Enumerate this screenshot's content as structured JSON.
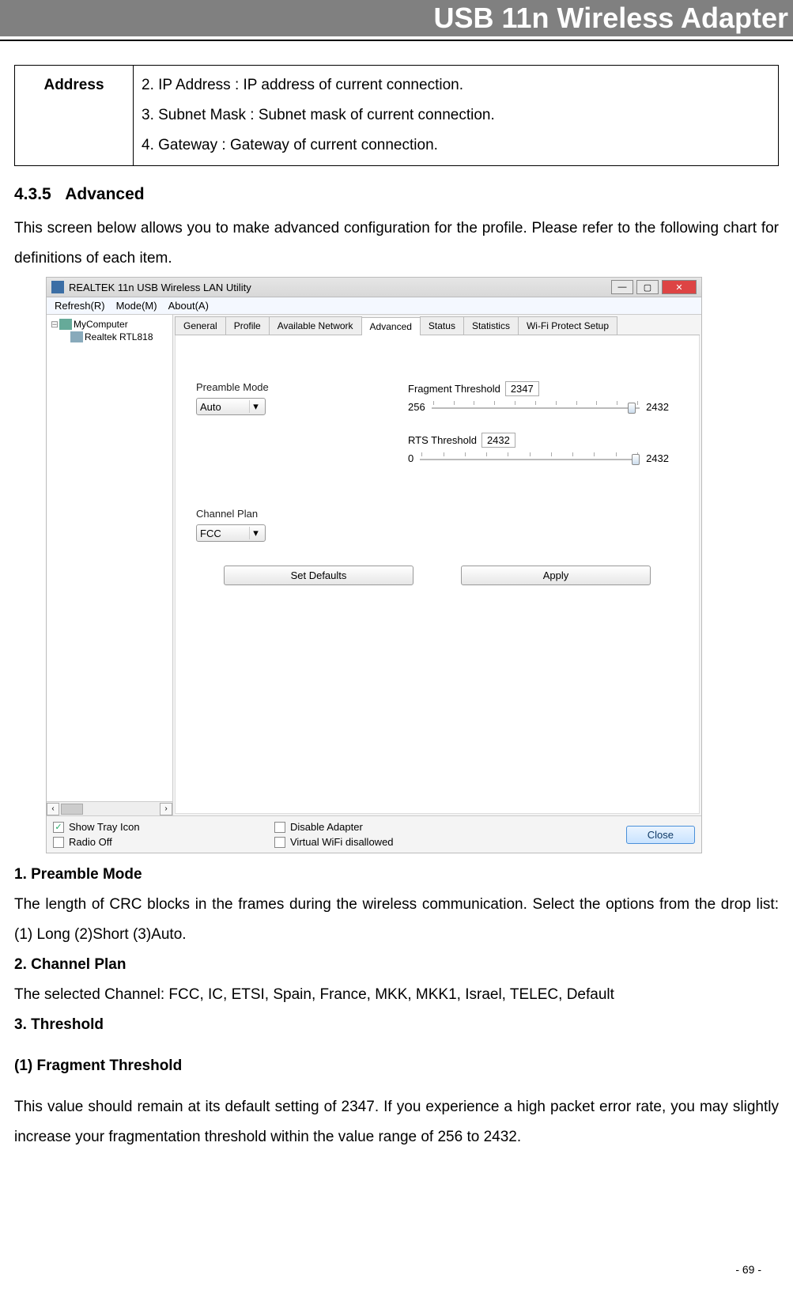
{
  "header": {
    "title": "USB 11n Wireless Adapter"
  },
  "def_table": {
    "label": "Address",
    "rows": [
      "2. IP Address : IP address of current connection.",
      "3. Subnet Mask : Subnet mask of current connection.",
      "4. Gateway : Gateway of current connection."
    ]
  },
  "section": {
    "number": "4.3.5",
    "title": "Advanced",
    "intro": "This screen below allows you to make advanced configuration for the profile. Please refer to the following chart for definitions of each item."
  },
  "app": {
    "window_title": "REALTEK 11n USB Wireless LAN Utility",
    "menus": [
      "Refresh(R)",
      "Mode(M)",
      "About(A)"
    ],
    "tree": {
      "root": "MyComputer",
      "child": "Realtek RTL818"
    },
    "tabs": [
      "General",
      "Profile",
      "Available Network",
      "Advanced",
      "Status",
      "Statistics",
      "Wi-Fi Protect Setup"
    ],
    "active_tab": "Advanced",
    "advanced": {
      "preamble_label": "Preamble Mode",
      "preamble_value": "Auto",
      "channel_label": "Channel Plan",
      "channel_value": "FCC",
      "frag_label": "Fragment Threshold",
      "frag_value": "2347",
      "frag_min": "256",
      "frag_max": "2432",
      "rts_label": "RTS Threshold",
      "rts_value": "2432",
      "rts_min": "0",
      "rts_max": "2432",
      "set_defaults": "Set Defaults",
      "apply": "Apply"
    },
    "bottom": {
      "show_tray": "Show Tray Icon",
      "radio_off": "Radio Off",
      "disable_adapter": "Disable Adapter",
      "virtual_wifi": "Virtual WiFi disallowed",
      "close": "Close"
    }
  },
  "post": {
    "h1": "1. Preamble Mode",
    "p1": "The length of CRC blocks in the frames during the wireless communication. Select the options from the drop list: (1) Long   (2)Short   (3)Auto.",
    "h2": "2. Channel Plan",
    "p2": "The selected Channel: FCC, IC, ETSI, Spain, France, MKK, MKK1, Israel, TELEC, Default",
    "h3": "3. Threshold",
    "h4": "(1) Fragment Threshold",
    "p4": "This value should remain at its default setting of 2347. If you experience a high packet error rate, you may slightly increase your fragmentation threshold within the value range of 256 to 2432."
  },
  "page_num": "- 69 -"
}
